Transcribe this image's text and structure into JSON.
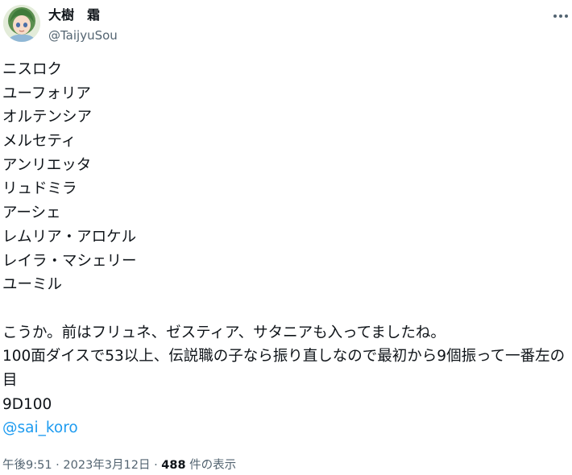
{
  "author": {
    "display_name": "大樹　霜",
    "handle": "@TaijyuSou"
  },
  "tweet": {
    "list_lines": [
      "ニスロク",
      "ユーフォリア",
      "オルテンシア",
      "メルセティ",
      "アンリエッタ",
      "リュドミラ",
      "アーシェ",
      "レムリア・アロケル",
      "レイラ・マシェリー",
      "ユーミル"
    ],
    "paragraph_1": "こうか。前はフリュネ、ゼスティア、サタニアも入ってましたね。",
    "paragraph_2": "100面ダイスで53以上、伝説職の子なら振り直しなので最初から9個振って一番左の目",
    "paragraph_3": "9D100",
    "mention": "@sai_koro"
  },
  "meta": {
    "time": "午後9:51",
    "separator_1": " · ",
    "date": "2023年3月12日",
    "separator_2": " · ",
    "views_count": "488",
    "views_label": " 件の表示"
  },
  "icons": {
    "more": "more-horizontal-icon",
    "avatar": "anime-character-avatar"
  },
  "colors": {
    "text": "#0f1419",
    "secondary": "#536471",
    "link": "#1d9bf0"
  }
}
